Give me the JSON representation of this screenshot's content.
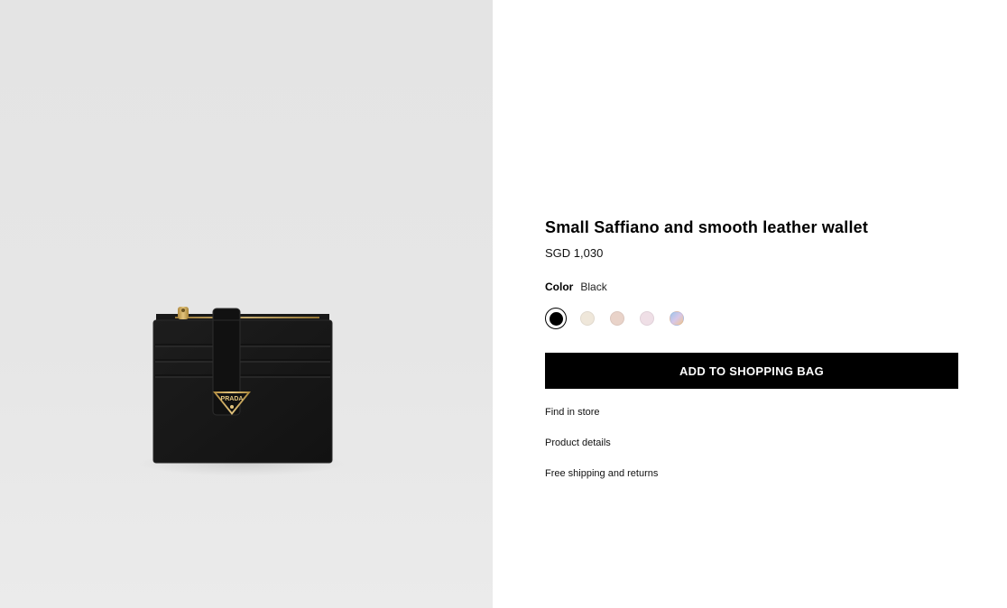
{
  "product": {
    "title": "Small Saffiano and smooth leather wallet",
    "price": "SGD 1,030",
    "brand_plate": "PRADA",
    "color_label": "Color",
    "color_value": "Black",
    "swatches": [
      {
        "name": "Black",
        "color": "#000000",
        "selected": true
      },
      {
        "name": "Cream",
        "color": "#efe7da",
        "selected": false
      },
      {
        "name": "Powder pink",
        "color": "#e9d3c9",
        "selected": false
      },
      {
        "name": "Pale pink",
        "color": "#efdfe6",
        "selected": false
      },
      {
        "name": "Multicolor",
        "color": "#a7c9e6",
        "selected": false
      }
    ]
  },
  "actions": {
    "add_to_bag_label": "ADD TO SHOPPING BAG",
    "find_in_store_label": "Find in store",
    "product_details_label": "Product details",
    "shipping_label": "Free shipping and returns"
  },
  "colors": {
    "button_bg": "#000000",
    "button_text": "#ffffff",
    "gallery_bg": "#e5e5e5"
  }
}
